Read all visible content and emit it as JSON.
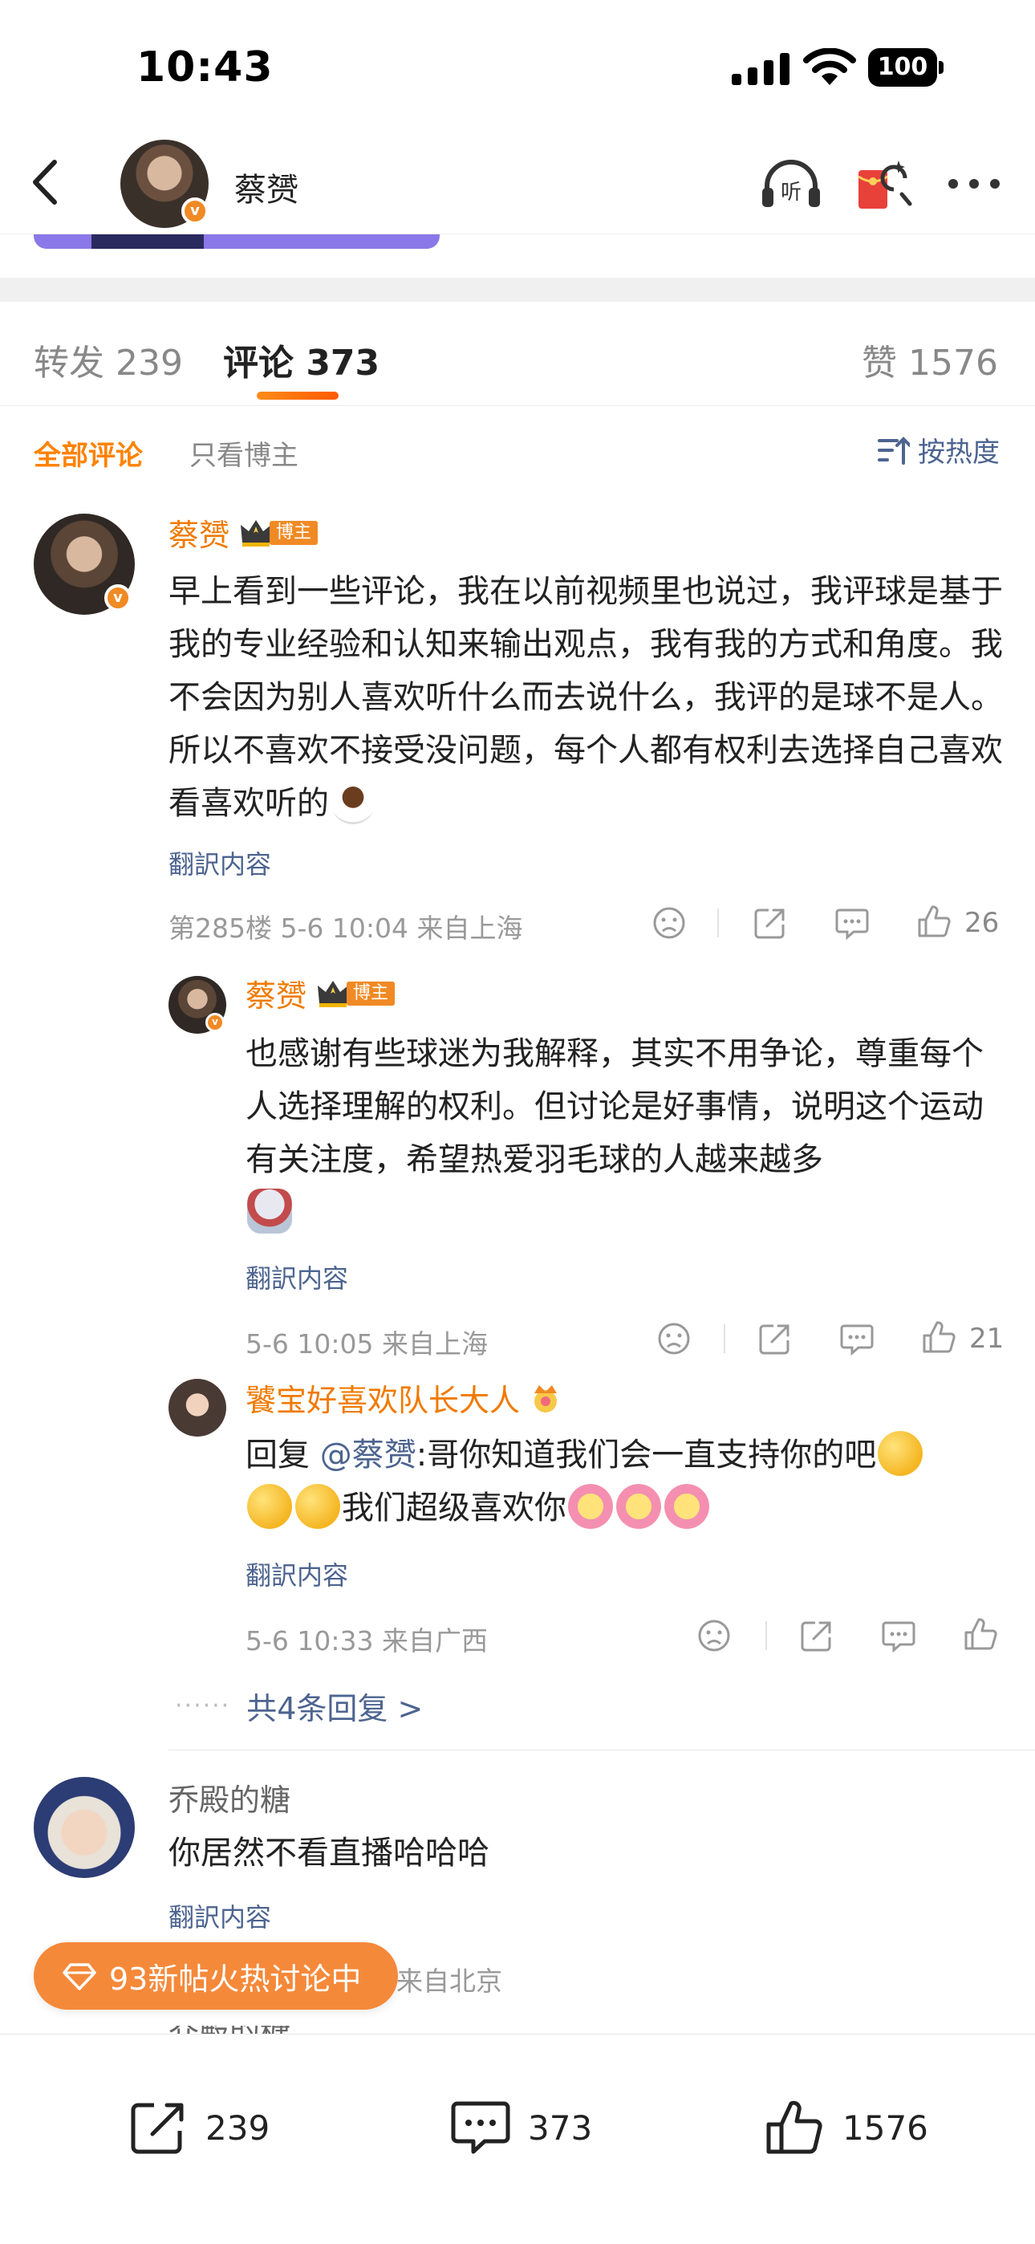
{
  "status_bar": {
    "time": "10:43",
    "battery": "100"
  },
  "nav": {
    "title": "蔡赟"
  },
  "tabs": {
    "repost": "转发 239",
    "comment": "评论 373",
    "like": "赞 1576"
  },
  "filters": {
    "all": "全部评论",
    "owner_only": "只看博主",
    "sort": "按热度"
  },
  "owner_badge_label": "博主",
  "translate_label": "翻訳内容",
  "comments": [
    {
      "author": "蔡赟",
      "text": "早上看到一些评论，我在以前视频里也说过，我评球是基于我的专业经验和认知来输出观点，我有我的方式和角度。我不会因为别人喜欢听什么而去说什么，我评的是球不是人。所以不喜欢不接受没问题，每个人都有权利去选择自己喜欢看喜欢听的",
      "meta": "第285楼  5-6 10:04  来自上海",
      "likes": "26"
    },
    {
      "author": "蔡赟",
      "text": "也感谢有些球迷为我解释，其实不用争论，尊重每个人选择理解的权利。但讨论是好事情，说明这个运动有关注度，希望热爱羽毛球的人越来越多",
      "meta": "5-6 10:05  来自上海",
      "likes": "21"
    },
    {
      "author": "饕宝好喜欢队长大人",
      "reply_prefix": "回复 ",
      "mention": "@蔡赟",
      "text_1": ":哥你知道我们会一直支持你的吧",
      "text_2": "我们超级喜欢你",
      "meta": "5-6 10:33  来自广西"
    },
    {
      "author": "乔殿的糖",
      "text": "你居然不看直播哈哈哈",
      "meta_location": "来自北京"
    }
  ],
  "more_replies": "共4条回复 >",
  "hot_pill": "93新帖火热讨论中",
  "bottom_bar": {
    "repost": "239",
    "comment": "373",
    "like": "1576"
  },
  "clipped_next_author": "乔殿的糖",
  "colors": {
    "accent": "#ff8200",
    "link": "#4d6490",
    "pill": "#f5893a"
  }
}
